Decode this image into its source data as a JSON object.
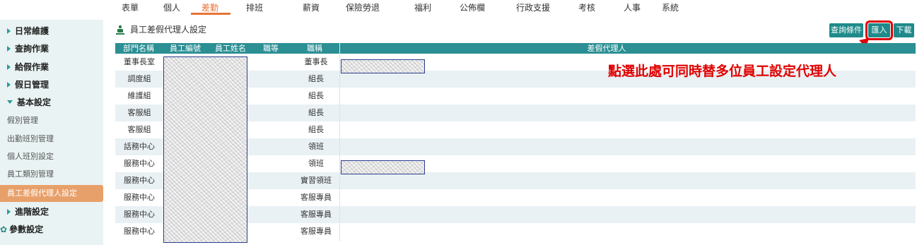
{
  "topnav": {
    "items": [
      "表單",
      "個人",
      "差勤",
      "排班",
      "薪資",
      "保險勞退",
      "福利",
      "公佈欄",
      "行政支援",
      "考核",
      "人事",
      "系統"
    ],
    "active_index": 2
  },
  "sidebar": {
    "items": [
      {
        "label": "日常維護"
      },
      {
        "label": "查詢作業"
      },
      {
        "label": "給假作業"
      },
      {
        "label": "假日管理"
      },
      {
        "label": "基本設定"
      },
      {
        "label": "假別管理"
      },
      {
        "label": "出勤班別管理"
      },
      {
        "label": "個人班別設定"
      },
      {
        "label": "員工類別管理"
      },
      {
        "label": "員工差假代理人設定"
      },
      {
        "label": "進階設定"
      },
      {
        "label": "參數設定"
      }
    ],
    "active_label": "員工差假代理人設定"
  },
  "page": {
    "title": "員工差假代理人設定"
  },
  "buttons": {
    "query": "查詢條件",
    "import": "匯入",
    "download": "下載"
  },
  "table": {
    "headers": [
      "部門名稱",
      "員工編號",
      "員工姓名",
      "職等",
      "職稱",
      "差假代理人"
    ],
    "rows": [
      {
        "dept": "董事長室",
        "title": "董事長",
        "has_agent": true
      },
      {
        "dept": "調度組",
        "title": "組長",
        "has_agent": false
      },
      {
        "dept": "維護組",
        "title": "組長",
        "has_agent": false
      },
      {
        "dept": "客服組",
        "title": "組長",
        "has_agent": false
      },
      {
        "dept": "客服組",
        "title": "組長",
        "has_agent": false
      },
      {
        "dept": "話務中心",
        "title": "領班",
        "has_agent": false
      },
      {
        "dept": "服務中心",
        "title": "領班",
        "has_agent": true
      },
      {
        "dept": "服務中心",
        "title": "實習領班",
        "has_agent": false
      },
      {
        "dept": "服務中心",
        "title": "客服專員",
        "has_agent": false
      },
      {
        "dept": "服務中心",
        "title": "客服專員",
        "has_agent": false
      },
      {
        "dept": "服務中心",
        "title": "客服專員",
        "has_agent": false
      }
    ]
  },
  "annotation": {
    "text": "點選此處可同時替多位員工設定代理人",
    "color": "#e00000"
  },
  "colors": {
    "accent": "#e8733a",
    "teal": "#1f8a8a",
    "header": "#2b8f94",
    "sidebar_bg": "#eaf3f3",
    "active_side": "#e8a06a"
  }
}
